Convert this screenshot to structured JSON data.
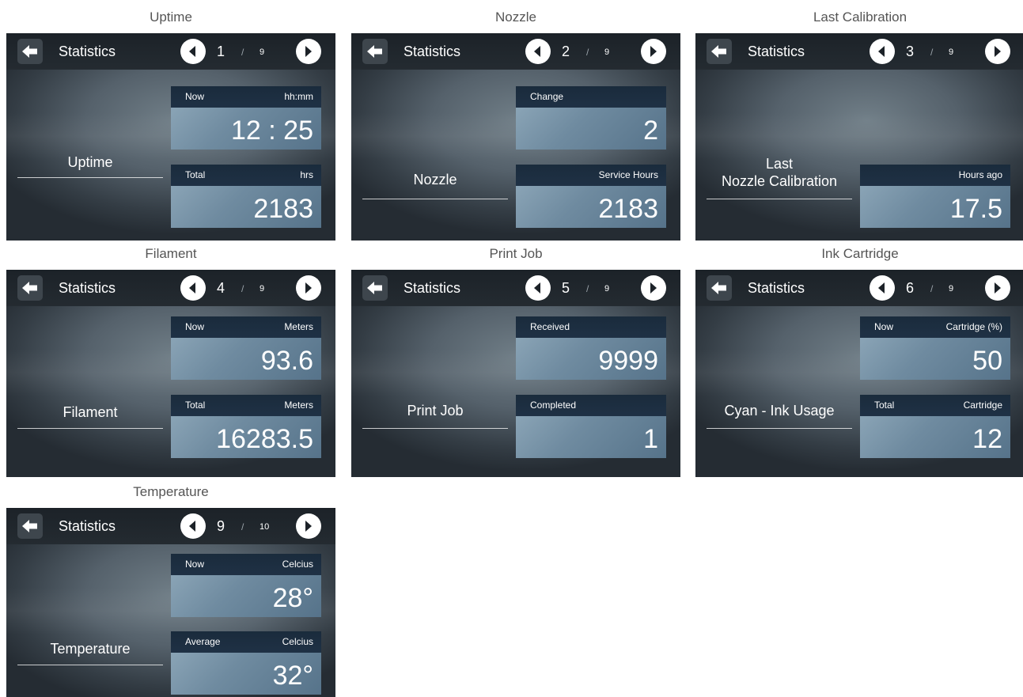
{
  "panels": [
    {
      "caption": "Uptime",
      "title": "Statistics",
      "page": "1",
      "separator": "/",
      "total": "9",
      "label": "Uptime",
      "top_box": {
        "left": "Now",
        "right": "hh:mm",
        "value": "12 : 25"
      },
      "bottom_box": {
        "left": "Total",
        "right": "hrs",
        "value": "2183"
      }
    },
    {
      "caption": "Nozzle",
      "title": "Statistics",
      "page": "2",
      "separator": "/",
      "total": "9",
      "label": "Nozzle",
      "top_box": {
        "left": "Change",
        "right": "",
        "value": "2"
      },
      "bottom_box": {
        "left": "",
        "right": "Service Hours",
        "value": "2183"
      }
    },
    {
      "caption": "Last Calibration",
      "title": "Statistics",
      "page": "3",
      "separator": "/",
      "total": "9",
      "label_line1": "Last",
      "label_line2": "Nozzle Calibration",
      "bottom_box": {
        "left": "",
        "right": "Hours ago",
        "value": "17.5"
      }
    },
    {
      "caption": "Filament",
      "title": "Statistics",
      "page": "4",
      "separator": "/",
      "total": "9",
      "label": "Filament",
      "top_box": {
        "left": "Now",
        "right": "Meters",
        "value": "93.6"
      },
      "bottom_box": {
        "left": "Total",
        "right": "Meters",
        "value": "16283.5"
      }
    },
    {
      "caption": "Print Job",
      "title": "Statistics",
      "page": "5",
      "separator": "/",
      "total": "9",
      "label": "Print Job",
      "top_box": {
        "left": "Received",
        "right": "",
        "value": "9999"
      },
      "bottom_box": {
        "left": "Completed",
        "right": "",
        "value": "1"
      }
    },
    {
      "caption": "Ink Cartridge",
      "title": "Statistics",
      "page": "6",
      "separator": "/",
      "total": "9",
      "label": "Cyan - Ink Usage",
      "top_box": {
        "left": "Now",
        "right": "Cartridge (%)",
        "value": "50"
      },
      "bottom_box": {
        "left": "Total",
        "right": "Cartridge",
        "value": "12"
      }
    },
    {
      "caption": "Temperature",
      "title": "Statistics",
      "page": "9",
      "separator": "/",
      "total": "10",
      "label": "Temperature",
      "top_box": {
        "left": "Now",
        "right": "Celcius",
        "value": "28°"
      },
      "bottom_box": {
        "left": "Average",
        "right": "Celcius",
        "value": "32°"
      }
    }
  ],
  "icons": {
    "back": "back-arrow-icon",
    "prev": "triangle-left-icon",
    "next": "triangle-right-icon"
  },
  "colors": {
    "topbar": "#1c2228",
    "box_header": "#1a2b3c",
    "box_body": "#7792a6",
    "screen_bg": "#55616b",
    "nav_button": "#ffffff"
  }
}
